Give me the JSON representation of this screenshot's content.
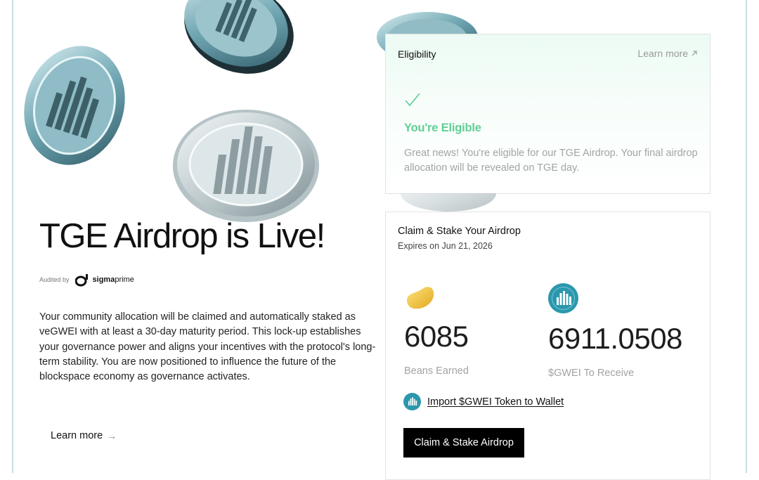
{
  "hero": {
    "title": "TGE Airdrop is Live!",
    "audit_label": "Audited by",
    "auditor_name": "sigma",
    "auditor_suffix": "prime",
    "description": "Your community allocation will be claimed and automatically staked as veGWEI with at least a 30-day maturity period. This lock-up establishes your governance power and aligns your incentives with the protocol's long-term stability. You are now positioned to influence the future of the blockspace economy as governance activates.",
    "learn_more": "Learn more"
  },
  "eligibility": {
    "title": "Eligibility",
    "learn_more": "Learn more",
    "status_title": "You're Eligible",
    "status_text": "Great news! You're eligible for our TGE Airdrop. Your final airdrop allocation will be revealed on TGE day."
  },
  "claim": {
    "title": "Claim & Stake Your Airdrop",
    "expires": "Expires on Jun 21, 2026",
    "beans_value": "6085",
    "beans_label": "Beans Earned",
    "gwei_value": "6911.0508",
    "gwei_label": "$GWEI To Receive",
    "import_link": "Import $GWEI Token to Wallet",
    "button": "Claim & Stake Airdrop"
  },
  "icons": {
    "coin": "gwei-coin-icon",
    "bean": "bean-icon",
    "check": "check-icon",
    "arrow_up_right": "arrow-up-right-icon",
    "arrow_right": "arrow-right-icon"
  },
  "colors": {
    "accent_green": "#5fcf94",
    "gwei_teal": "#2b97ad",
    "bean_yellow": "#f3c63a",
    "button_black": "#000000",
    "frame": "#c5dde3"
  }
}
